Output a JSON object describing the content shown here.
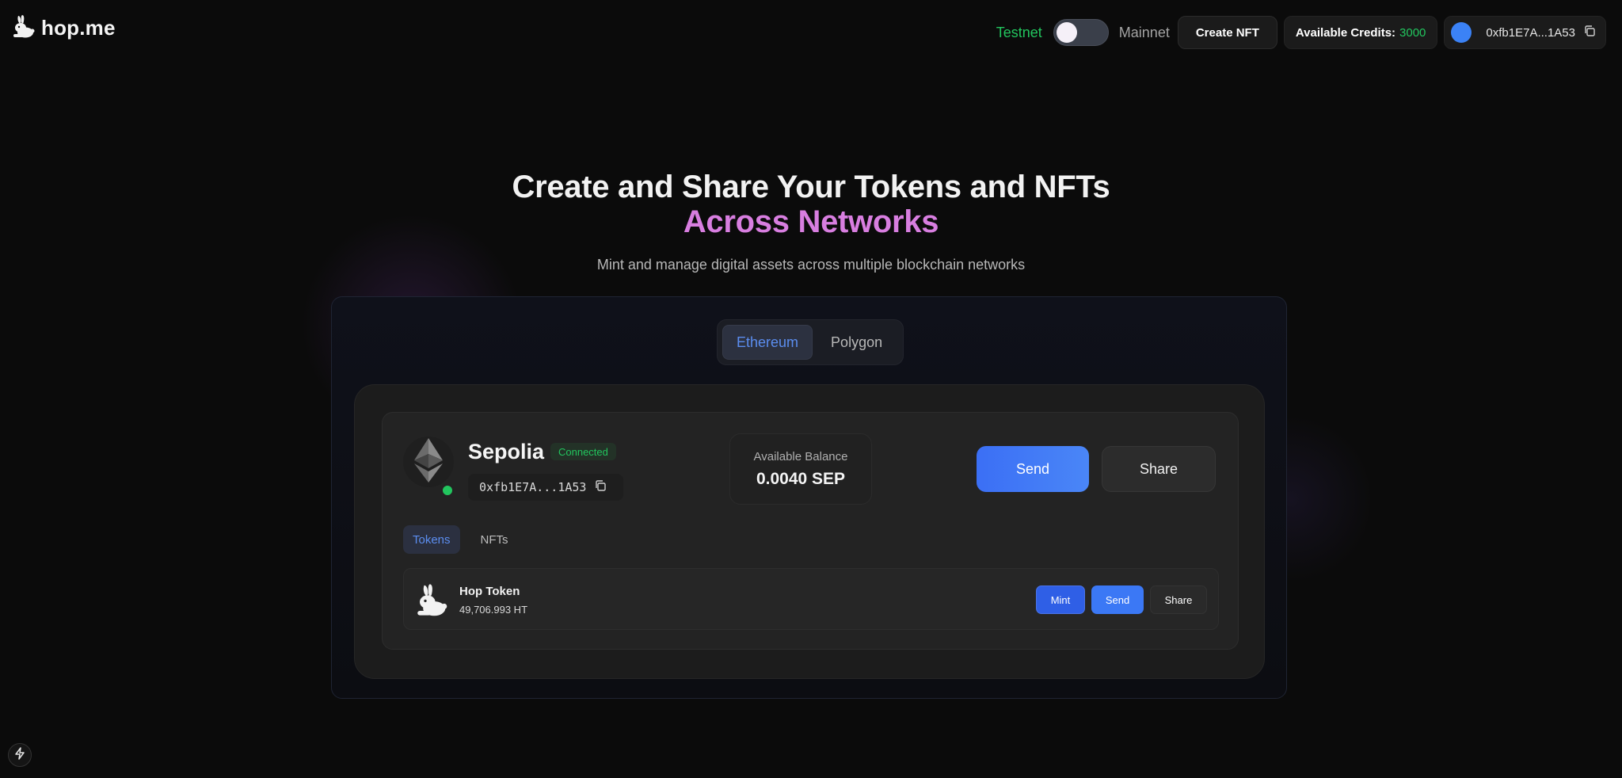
{
  "header": {
    "logo_text": "hop.me",
    "testnet_label": "Testnet",
    "mainnet_label": "Mainnet",
    "create_nft_label": "Create NFT",
    "credits_label": "Available Credits:",
    "credits_value": "3000",
    "wallet_address": "0xfb1E7A...1A53"
  },
  "hero": {
    "title": "Create and Share Your Tokens and NFTs",
    "title_accent": "Across Networks",
    "subtitle": "Mint and manage digital assets across multiple blockchain networks"
  },
  "network_tabs": [
    {
      "label": "Ethereum",
      "active": true
    },
    {
      "label": "Polygon",
      "active": false
    }
  ],
  "network_card": {
    "name": "Sepolia",
    "status": "Connected",
    "address": "0xfb1E7A...1A53",
    "balance_label": "Available Balance",
    "balance_value": "0.0040 SEP",
    "send_label": "Send",
    "share_label": "Share"
  },
  "asset_tabs": [
    {
      "label": "Tokens",
      "active": true
    },
    {
      "label": "NFTs",
      "active": false
    }
  ],
  "tokens": [
    {
      "name": "Hop Token",
      "amount": "49,706.993 HT",
      "mint_label": "Mint",
      "send_label": "Send",
      "share_label": "Share"
    }
  ],
  "colors": {
    "accent_blue": "#3b82f6",
    "accent_green": "#22c55e",
    "accent_pink": "#d87ee0"
  }
}
